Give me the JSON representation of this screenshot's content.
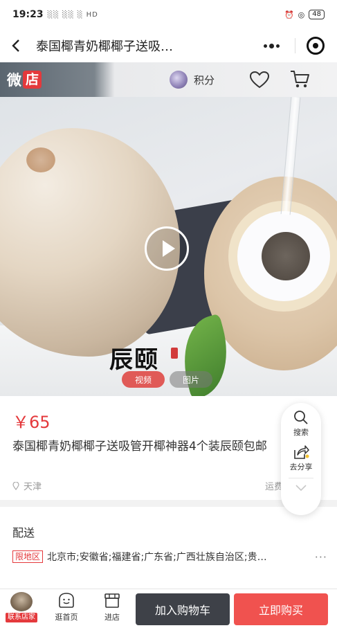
{
  "status_bar": {
    "time": "19:23",
    "signal": "░░ ░░ ░ HD",
    "battery": "48"
  },
  "title_bar": {
    "title": "泰国椰青奶椰椰子送吸…"
  },
  "shop_header": {
    "logo_part1": "微",
    "logo_part2": "店",
    "points_label": "积分"
  },
  "hero": {
    "brand_text": "辰颐",
    "tab_video": "视频",
    "tab_picture": "图片"
  },
  "product": {
    "price": "￥65",
    "title": "泰国椰青奶椰椰子送吸管开椰神器4个装辰颐包邮",
    "location": "天津",
    "shipping_label": "运费"
  },
  "delivery": {
    "heading": "配送",
    "restricted_tag": "限地区",
    "areas": "北京市;安徽省;福建省;广东省;广西壮族自治区;贵…"
  },
  "float_panel": {
    "search_label": "搜索",
    "share_label": "去分享"
  },
  "bottom_bar": {
    "contact_seller": "联系店家",
    "home_label": "逛首页",
    "shop_label": "进店",
    "add_to_cart": "加入购物车",
    "buy_now": "立即购买"
  },
  "colors": {
    "accent_red": "#e4393c",
    "buy_button": "#f0524f",
    "cart_button": "#3e4148"
  }
}
